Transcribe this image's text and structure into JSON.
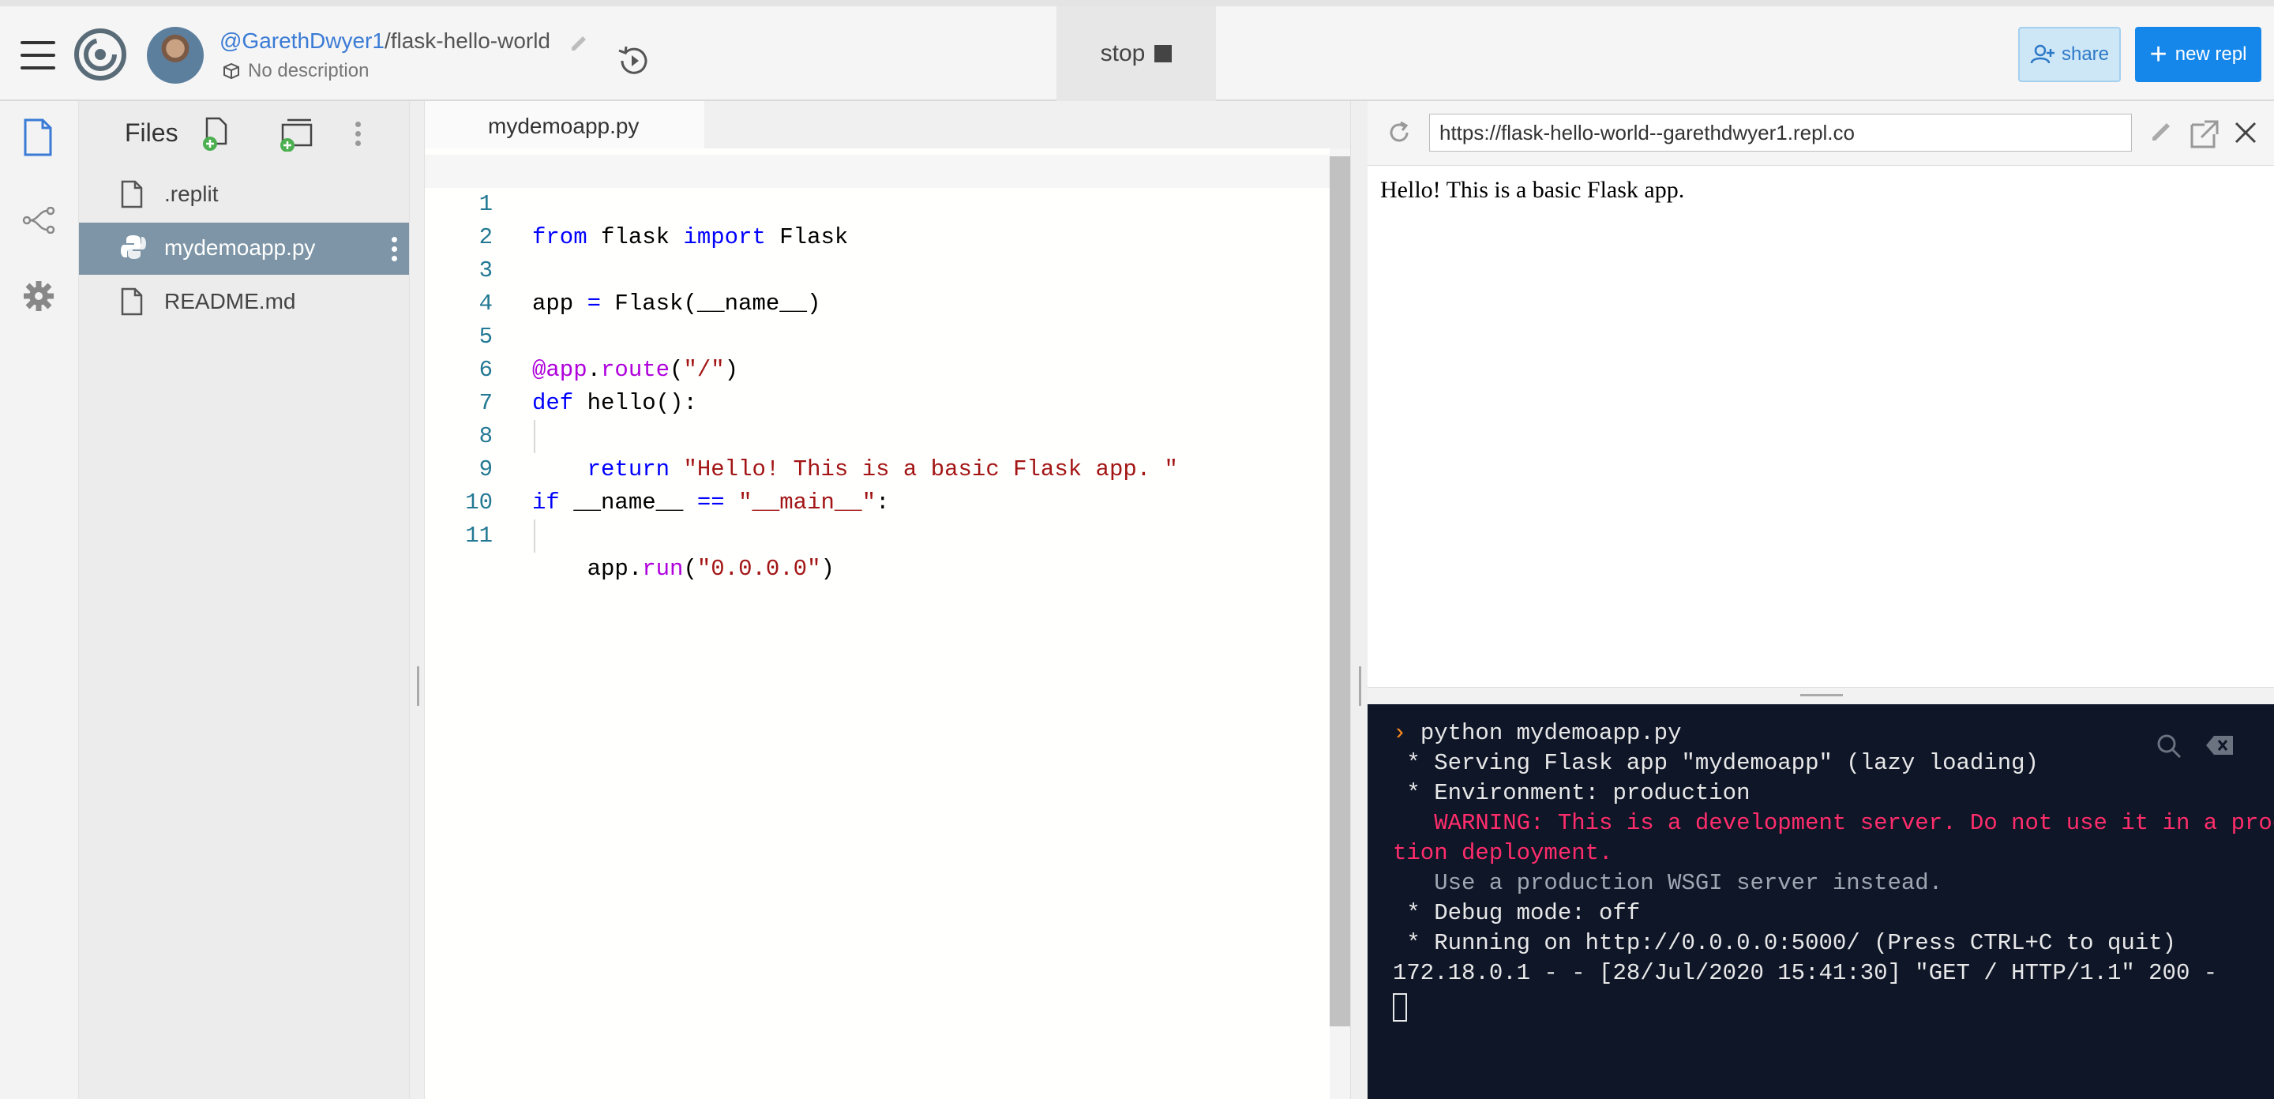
{
  "header": {
    "username": "@GarethDwyer1",
    "separator": "/",
    "repl_name": "flask-hello-world",
    "description": "No description",
    "stop_label": "stop",
    "share_label": "share",
    "new_repl_label": "new repl"
  },
  "files": {
    "title": "Files",
    "items": [
      {
        "name": ".replit",
        "icon": "file-icon"
      },
      {
        "name": "mydemoapp.py",
        "icon": "python-icon",
        "active": true
      },
      {
        "name": "README.md",
        "icon": "file-icon"
      }
    ]
  },
  "editor": {
    "tab": "mydemoapp.py",
    "line_numbers": [
      "1",
      "2",
      "3",
      "4",
      "5",
      "6",
      "7",
      "8",
      "9",
      "10",
      "11"
    ]
  },
  "webview": {
    "url": "https://flask-hello-world--garethdwyer1.repl.co",
    "content": "Hello! This is a basic Flask app."
  },
  "console": {
    "lines": [
      "python mydemoapp.py",
      " * Serving Flask app \"mydemoapp\" (lazy loading)",
      " * Environment: production",
      "   WARNING: This is a development server. Do not use it in a produc",
      "tion deployment.",
      "   Use a production WSGI server instead.",
      " * Debug mode: off",
      " * Running on http://0.0.0.0:5000/ (Press CTRL+C to quit)",
      "172.18.0.1 - - [28/Jul/2020 15:41:30] \"GET / HTTP/1.1\" 200 -"
    ]
  },
  "colors": {
    "accent": "#1587eb",
    "link": "#3a7bd5",
    "console_bg": "#0e1628",
    "warning": "#ff2d6b",
    "active_file": "#7d95a6"
  }
}
